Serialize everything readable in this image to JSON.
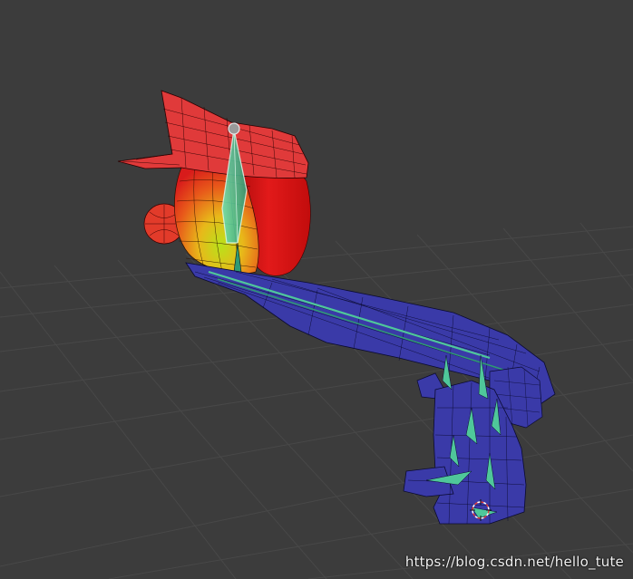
{
  "watermark": {
    "text": "https://blog.csdn.net/hello_tute"
  },
  "colors": {
    "background": "#3c3c3c",
    "grid": "#4a4a4a",
    "weight_high": "#e8141a",
    "weight_mid": "#7fd11a",
    "weight_zero": "#33339a",
    "bone": "#4fc79a",
    "wire": "#111111"
  },
  "icons": {
    "bone_head": "circle-icon",
    "cursor": "3d-cursor-icon"
  }
}
